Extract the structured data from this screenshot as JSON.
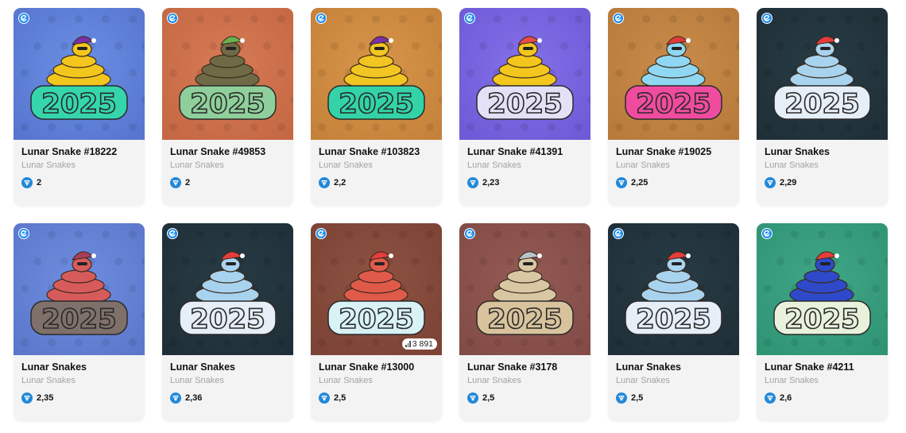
{
  "cards": [
    {
      "title": "Lunar Snake #18222",
      "collection": "Lunar Snakes",
      "price": "2",
      "bg": "#6a8fe3",
      "bg2": "#5775cf",
      "snake": "#f3c61e",
      "num": "#35d6ab",
      "hat": "#7b2fa8"
    },
    {
      "title": "Lunar Snake #49853",
      "collection": "Lunar Snakes",
      "price": "2",
      "bg": "#d77a56",
      "bg2": "#c46843",
      "snake": "#6e6a46",
      "num": "#8fcf9b",
      "hat": "#67b24f"
    },
    {
      "title": "Lunar Snake #103823",
      "collection": "Lunar Snakes",
      "price": "2,2",
      "bg": "#d7954a",
      "bg2": "#c58139",
      "snake": "#f2c622",
      "num": "#33d3a7",
      "hat": "#7b2fa8"
    },
    {
      "title": "Lunar Snake #41391",
      "collection": "Lunar Snakes",
      "price": "2,23",
      "bg": "#8470e8",
      "bg2": "#6e5ad6",
      "snake": "#f3c61e",
      "num": "#e4e1f6",
      "hat": "#e94a4a"
    },
    {
      "title": "Lunar Snake #19025",
      "collection": "Lunar Snakes",
      "price": "2,25",
      "bg": "#c98c4b",
      "bg2": "#b77a3a",
      "snake": "#8fd7f2",
      "num": "#f04c9f",
      "hat": "#e03b3b"
    },
    {
      "title": "Lunar Snakes",
      "collection": "Lunar Snakes",
      "price": "2,29",
      "bg": "#283b44",
      "bg2": "#1f2f37",
      "snake": "#a8d3ef",
      "num": "#e6eef8",
      "hat": "#e53d3d"
    },
    {
      "title": "Lunar Snakes",
      "collection": "Lunar Snakes",
      "price": "2,35",
      "bg": "#6f8ddf",
      "bg2": "#5b77cb",
      "snake": "#d85b5b",
      "num": "#7f716a",
      "hat": "#a93e58"
    },
    {
      "title": "Lunar Snakes",
      "collection": "Lunar Snakes",
      "price": "2,36",
      "bg": "#283b44",
      "bg2": "#1f2f37",
      "snake": "#a8d3ef",
      "num": "#e6eef8",
      "hat": "#e53d3d"
    },
    {
      "title": "Lunar Snake #13000",
      "collection": "Lunar Snakes",
      "price": "2,5",
      "bg": "#8e5242",
      "bg2": "#7b4335",
      "snake": "#e05a4a",
      "num": "#d8f2f6",
      "hat": "#e53d3d",
      "badge": "3 891"
    },
    {
      "title": "Lunar Snake #3178",
      "collection": "Lunar Snakes",
      "price": "2,5",
      "bg": "#955b55",
      "bg2": "#824b46",
      "snake": "#d8c7a2",
      "num": "#d8c39d",
      "hat": "#b9c4c9"
    },
    {
      "title": "Lunar Snakes",
      "collection": "Lunar Snakes",
      "price": "2,5",
      "bg": "#283b44",
      "bg2": "#1f2f37",
      "snake": "#a8d3ef",
      "num": "#e6eef8",
      "hat": "#e53d3d"
    },
    {
      "title": "Lunar Snake #4211",
      "collection": "Lunar Snakes",
      "price": "2,6",
      "bg": "#3fa687",
      "bg2": "#2f9474",
      "snake": "#2e49c9",
      "num": "#e8f1dc",
      "hat": "#e53d3d"
    }
  ]
}
